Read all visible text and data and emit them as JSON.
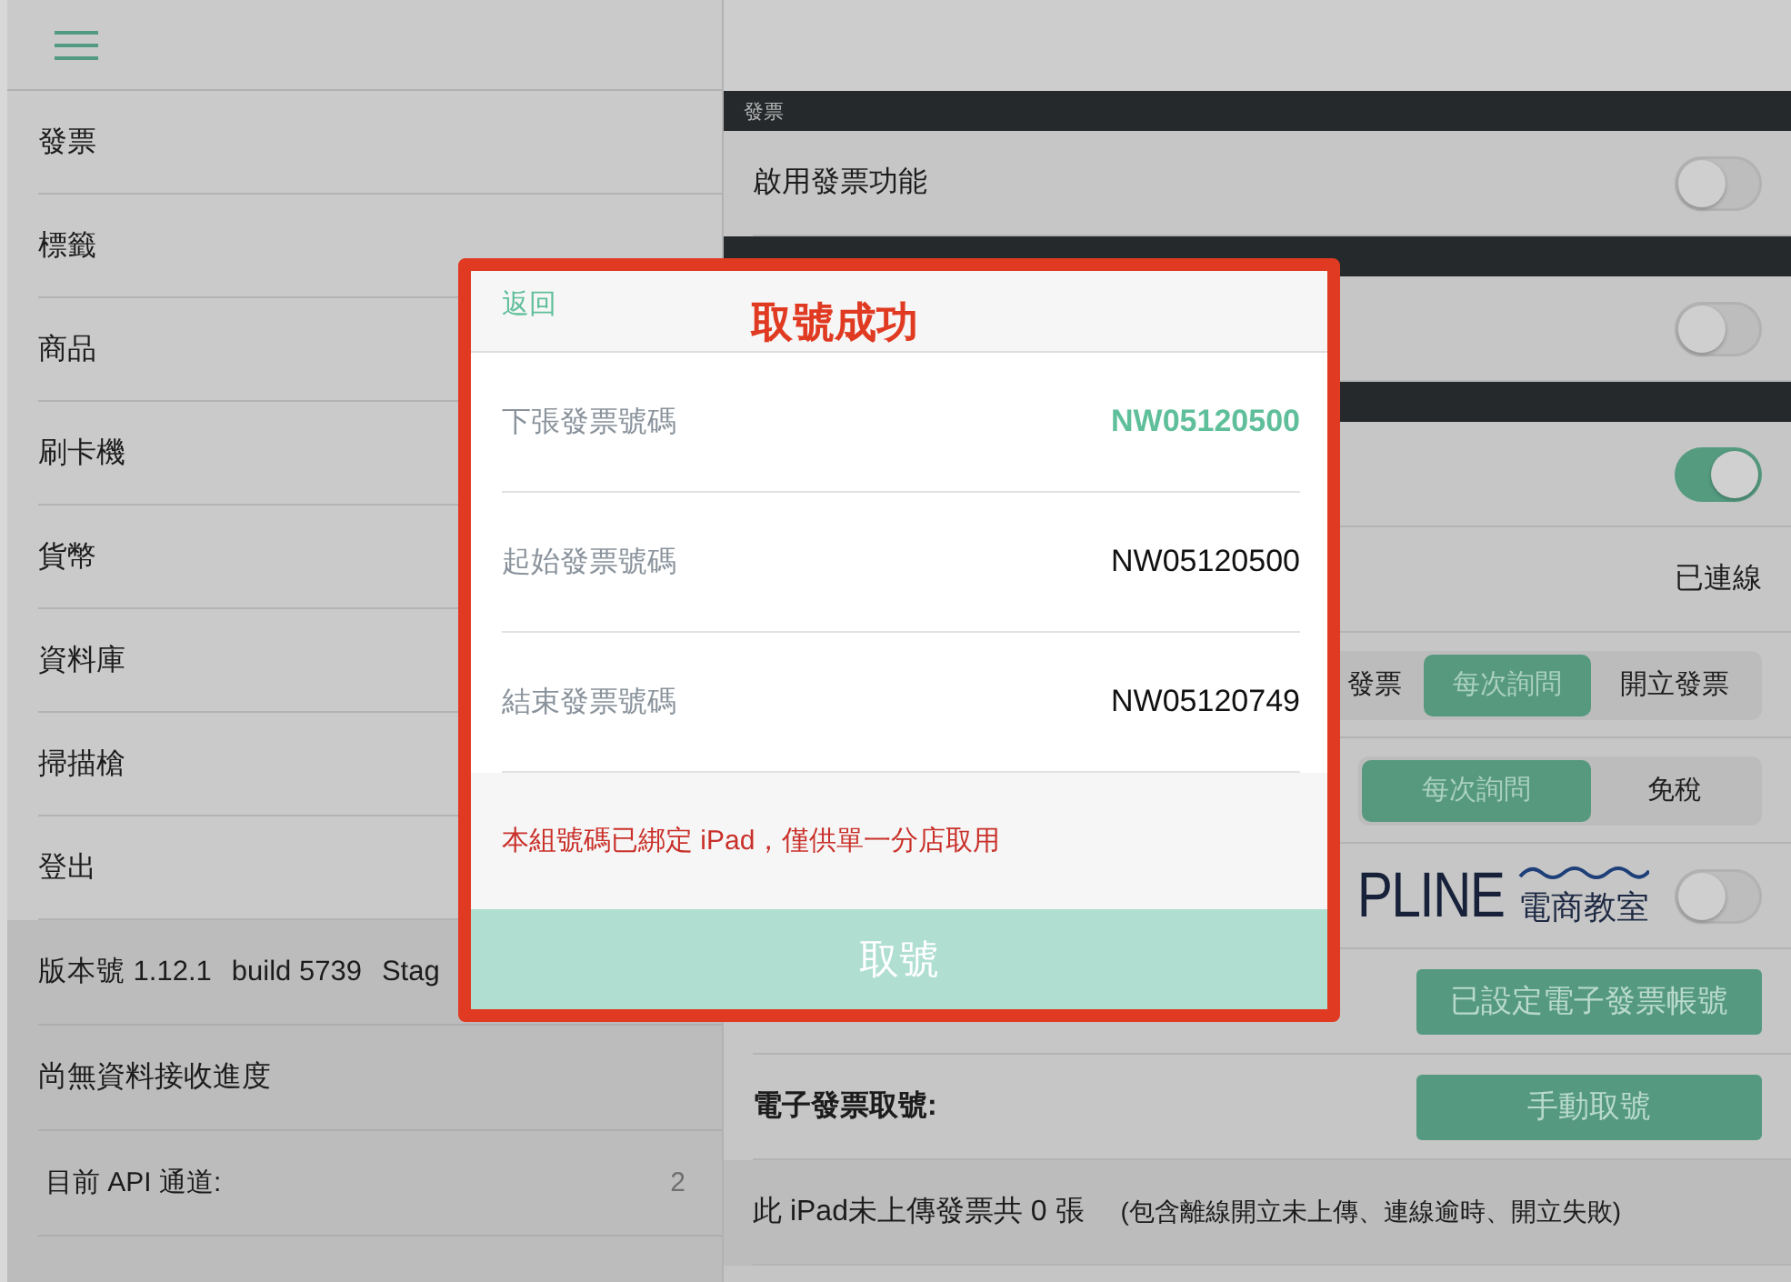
{
  "sidebar": {
    "items": [
      {
        "label": "發票"
      },
      {
        "label": "標籤"
      },
      {
        "label": "商品"
      },
      {
        "label": "刷卡機"
      },
      {
        "label": "貨幣"
      },
      {
        "label": "資料庫"
      },
      {
        "label": "掃描槍"
      },
      {
        "label": "登出"
      }
    ],
    "version": [
      "版本號 1.12.1",
      "build 5739",
      "Stag"
    ],
    "progress": "尚無資料接收進度",
    "api_channel": {
      "label": "目前 API 通道:",
      "value": "2"
    }
  },
  "settings": {
    "rows": [
      {
        "kind": "header",
        "label": "發票"
      },
      {
        "kind": "toggle",
        "label": "啟用發票功能",
        "on": false
      },
      {
        "kind": "header"
      },
      {
        "kind": "toggle",
        "on": false
      },
      {
        "kind": "header"
      },
      {
        "kind": "toggle",
        "on": true
      },
      {
        "kind": "status",
        "value": "已連線"
      },
      {
        "kind": "segmented",
        "options": [
          {
            "label": "發票",
            "selected": false
          },
          {
            "label": "每次詢問",
            "selected": true
          },
          {
            "label": "開立發票",
            "selected": false
          }
        ]
      },
      {
        "kind": "segmented",
        "options": [
          {
            "label": "每次詢問",
            "selected": true
          },
          {
            "label": "免稅",
            "selected": false
          }
        ]
      },
      {
        "kind": "logo_toggle",
        "logo": {
          "wordmark": "PLINE",
          "caption": "電商教室"
        },
        "on": false
      },
      {
        "kind": "button",
        "button": "已設定電子發票帳號"
      },
      {
        "kind": "label_button",
        "label": "電子發票取號:",
        "button": "手動取號"
      },
      {
        "kind": "note",
        "text": "此 iPad未上傳發票共 0 張",
        "detail": "(包含離線開立未上傳、連線逾時、開立失敗)"
      }
    ]
  },
  "dialog": {
    "back": "返回",
    "title": "取號成功",
    "rows": [
      {
        "label": "下張發票號碼",
        "value": "NW05120500",
        "highlight": true
      },
      {
        "label": "起始發票號碼",
        "value": "NW05120500",
        "highlight": false
      },
      {
        "label": "結束發票號碼",
        "value": "NW05120749",
        "highlight": false
      }
    ],
    "notice": "本組號碼已綁定 iPad，僅供單一分店取用",
    "action": "取號"
  }
}
